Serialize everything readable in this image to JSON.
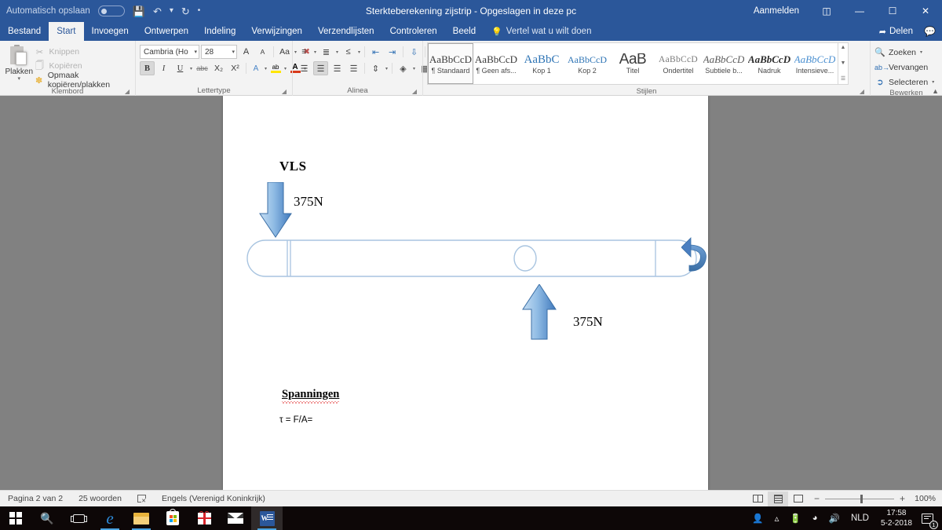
{
  "titlebar": {
    "autosave_label": "Automatisch opslaan",
    "save_icon": "save-icon",
    "undo_icon": "undo-icon",
    "redo_icon": "redo-icon",
    "more_icon": "more-icon",
    "document_title": "Sterkteberekening zijstrip  -  Opgeslagen in deze pc",
    "signin_label": "Aanmelden",
    "ribbon_display_icon": "ribbon-display-options-icon",
    "minimize_icon": "minimize-icon",
    "restore_icon": "restore-icon",
    "close_icon": "close-icon",
    "share_label": "Delen",
    "comments_icon": "comments-icon"
  },
  "tabs": [
    {
      "label": "Bestand",
      "active": false
    },
    {
      "label": "Start",
      "active": true
    },
    {
      "label": "Invoegen",
      "active": false
    },
    {
      "label": "Ontwerpen",
      "active": false
    },
    {
      "label": "Indeling",
      "active": false
    },
    {
      "label": "Verwijzingen",
      "active": false
    },
    {
      "label": "Verzendlijsten",
      "active": false
    },
    {
      "label": "Controleren",
      "active": false
    },
    {
      "label": "Beeld",
      "active": false
    }
  ],
  "tellme": {
    "icon": "lightbulb-icon",
    "label": "Vertel wat u wilt doen"
  },
  "ribbon": {
    "clipboard": {
      "group_label": "Klembord",
      "paste_label": "Plakken",
      "cut_label": "Knippen",
      "copy_label": "Kopiëren",
      "format_painter_label": "Opmaak kopiëren/plakken"
    },
    "font": {
      "group_label": "Lettertype",
      "font_name": "Cambria (Ho",
      "font_size": "28",
      "grow_label": "A",
      "shrink_label": "A",
      "case_label": "Aa",
      "clear_label": "A",
      "bold_label": "B",
      "italic_label": "I",
      "underline_label": "U",
      "strike_label": "abc",
      "subscript_label": "X₂",
      "superscript_label": "X²",
      "texteffects_label": "A",
      "highlight_label": "ab",
      "fontcolor_label": "A"
    },
    "paragraph": {
      "group_label": "Alinea",
      "bullets_label": "bullets-icon",
      "numbering_label": "numbering-icon",
      "multilevel_label": "multilevel-list-icon",
      "decrease_indent_label": "decrease-indent-icon",
      "increase_indent_label": "increase-indent-icon",
      "sort_label": "sort-icon",
      "marks_label": "¶",
      "align_left_label": "align-left-icon",
      "align_center_label": "align-center-icon",
      "align_right_label": "align-right-icon",
      "justify_label": "justify-icon",
      "line_spacing_label": "line-spacing-icon",
      "shading_label": "shading-icon",
      "borders_label": "borders-icon"
    },
    "styles": {
      "group_label": "Stijlen",
      "items": [
        {
          "preview": "AaBbCcD",
          "name": "Standaard",
          "pilcrow": true,
          "selected": true,
          "variant": "serif"
        },
        {
          "preview": "AaBbCcD",
          "name": "Geen afs...",
          "pilcrow": true,
          "selected": false,
          "variant": "serif"
        },
        {
          "preview": "AaBbC",
          "name": "Kop 1",
          "pilcrow": false,
          "selected": false,
          "variant": "blue"
        },
        {
          "preview": "AaBbCcD",
          "name": "Kop 2",
          "pilcrow": false,
          "selected": false,
          "variant": "blue-small"
        },
        {
          "preview": "AaB",
          "name": "Titel",
          "pilcrow": false,
          "selected": false,
          "variant": "big"
        },
        {
          "preview": "AaBbCcD",
          "name": "Ondertitel",
          "pilcrow": false,
          "selected": false,
          "variant": "gray"
        },
        {
          "preview": "AaBbCcD",
          "name": "Subtiele b...",
          "pilcrow": false,
          "selected": false,
          "variant": "italic"
        },
        {
          "preview": "AaBbCcD",
          "name": "Nadruk",
          "pilcrow": false,
          "selected": false,
          "variant": "bolditalic"
        },
        {
          "preview": "AaBbCcD",
          "name": "Intensieve...",
          "pilcrow": false,
          "selected": false,
          "variant": "blueitalic"
        }
      ]
    },
    "editing": {
      "group_label": "Bewerken",
      "find_label": "Zoeken",
      "replace_label": "Vervangen",
      "select_label": "Selecteren",
      "collapse_icon": "collapse-ribbon-icon"
    }
  },
  "document": {
    "heading": "VLS",
    "force_top": "375N",
    "force_bottom": "375N",
    "section_title": "Spanningen",
    "formula": "τ = F/A=",
    "shape_colors": {
      "arrow_light": "#9dc3e6",
      "arrow_dark": "#4a86c8",
      "arrow_stroke": "#3a6ea5",
      "beam_stroke": "#a8c4e0",
      "curved_arrow": "#4a7fc1"
    }
  },
  "statusbar": {
    "page_info": "Pagina 2 van 2",
    "word_count": "25 woorden",
    "proofing_icon": "proofing-errors-icon",
    "language": "Engels (Verenigd Koninkrijk)",
    "read_mode_icon": "read-mode-icon",
    "print_layout_icon": "print-layout-icon",
    "web_layout_icon": "web-layout-icon",
    "zoom_out": "−",
    "zoom_in": "+",
    "zoom_value": "100%"
  },
  "taskbar": {
    "start_icon": "windows-start-icon",
    "search_icon": "search-icon",
    "taskview_icon": "task-view-icon",
    "edge_icon": "edge-browser-icon",
    "explorer_icon": "file-explorer-icon",
    "store_icon": "microsoft-store-icon",
    "gift_icon": "gift-icon",
    "mail_icon": "mail-icon",
    "word_icon": "word-icon",
    "people_icon": "people-icon",
    "show_hidden_icon": "show-hidden-icons-chevron",
    "battery_icon": "battery-icon",
    "network_icon": "wifi-icon",
    "volume_icon": "volume-icon",
    "language": "NLD",
    "time": "17:58",
    "date": "5-2-2018",
    "notification_icon": "notifications-icon",
    "notification_count": "1"
  }
}
